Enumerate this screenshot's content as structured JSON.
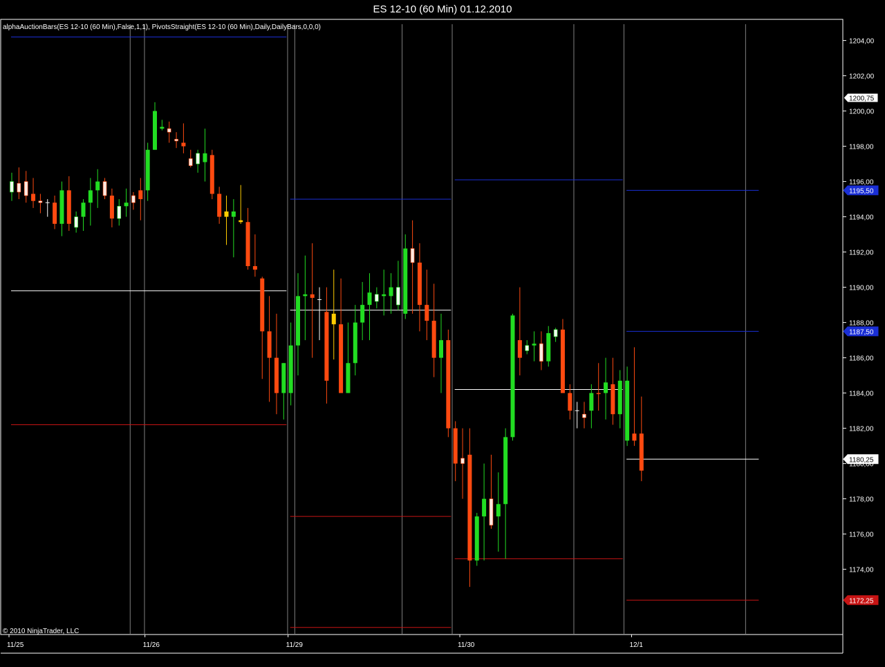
{
  "window": {
    "title": "ES 12-10 (60 Min)  01.12.2010"
  },
  "indicator_label": "alphaAuctionBars(ES 12-10 (60 Min),False,1,1), PivotsStraight(ES 12-10 (60 Min),Daily,DailyBars,0,0,0)",
  "copyright": "© 2010 NinjaTrader, LLC",
  "colors": {
    "background": "#000000",
    "border": "#ffffff",
    "up_strong": "#22dd22",
    "down_strong": "#ff4a10",
    "up_pale": "#eefcee",
    "down_pale": "#ffe8e0",
    "neutral": "#ffcc00",
    "pivot_resistance": "#1a2fd6",
    "pivot_pivot": "#ffffff",
    "pivot_support": "#c81414",
    "session_line": "#808080"
  },
  "price_tags": [
    {
      "label": "1200,75",
      "value": 1200.75,
      "style": "last"
    },
    {
      "label": "1195,50",
      "value": 1195.5,
      "style": "resistance"
    },
    {
      "label": "1187,50",
      "value": 1187.5,
      "style": "resistance"
    },
    {
      "label": "1180,25",
      "value": 1180.25,
      "style": "pivot"
    },
    {
      "label": "1172,25",
      "value": 1172.25,
      "style": "support"
    }
  ],
  "chart_data": {
    "type": "candlestick",
    "title": "ES 12-10 (60 Min)  01.12.2010",
    "ylim": [
      1170.3,
      1205.2
    ],
    "y_ticks": [
      {
        "value": 1174,
        "label": "1174,00"
      },
      {
        "value": 1176,
        "label": "1176,00"
      },
      {
        "value": 1178,
        "label": "1178,00"
      },
      {
        "value": 1180,
        "label": "1180,00"
      },
      {
        "value": 1182,
        "label": "1182,00"
      },
      {
        "value": 1184,
        "label": "1184,00"
      },
      {
        "value": 1186,
        "label": "1186,00"
      },
      {
        "value": 1188,
        "label": "1188,00"
      },
      {
        "value": 1190,
        "label": "1190,00"
      },
      {
        "value": 1192,
        "label": "1192,00"
      },
      {
        "value": 1194,
        "label": "1194,00"
      },
      {
        "value": 1196,
        "label": "1196,00"
      },
      {
        "value": 1198,
        "label": "1198,00"
      },
      {
        "value": 1200,
        "label": "1200,00"
      },
      {
        "value": 1202,
        "label": "1202,00"
      },
      {
        "value": 1204,
        "label": "1204,00"
      }
    ],
    "x_ticks": [
      {
        "bar": 0,
        "label": "11/25"
      },
      {
        "bar": 19,
        "label": "11/26"
      },
      {
        "bar": 39,
        "label": "11/29"
      },
      {
        "bar": 63,
        "label": "11/30"
      },
      {
        "bar": 87,
        "label": "12/1"
      }
    ],
    "session_lines": [
      16,
      18,
      38,
      39,
      54,
      61,
      78,
      85,
      102
    ],
    "pivot_segments": [
      {
        "bar_from": 0,
        "bar_to": 38,
        "r1": 1204.2,
        "pp": 1189.8,
        "s1": 1182.2
      },
      {
        "bar_from": 39,
        "bar_to": 61,
        "r1": 1195.0,
        "pp": 1188.7,
        "s1": 1177.0,
        "s2": 1170.7
      },
      {
        "bar_from": 62,
        "bar_to": 85,
        "r1": 1196.1,
        "pp": 1184.2,
        "s1": 1174.6
      },
      {
        "bar_from": 86,
        "bar_to": 104,
        "r1": 1195.5,
        "r2": 1187.5,
        "pp": 1180.25,
        "s1": 1172.25
      }
    ],
    "bars": [
      {
        "o": 1195.4,
        "h": 1196.5,
        "l": 1194.9,
        "c": 1196.0,
        "t": "upp"
      },
      {
        "o": 1195.9,
        "h": 1196.8,
        "l": 1195.0,
        "c": 1195.4,
        "t": "dnp"
      },
      {
        "o": 1195.2,
        "h": 1196.6,
        "l": 1194.8,
        "c": 1196.0,
        "t": "dnp"
      },
      {
        "o": 1195.3,
        "h": 1196.2,
        "l": 1194.5,
        "c": 1194.9,
        "t": "dn"
      },
      {
        "o": 1194.9,
        "h": 1195.3,
        "l": 1194.2,
        "c": 1194.8,
        "t": "dnp"
      },
      {
        "o": 1194.8,
        "h": 1195.0,
        "l": 1194.0,
        "c": 1194.8,
        "t": "doji"
      },
      {
        "o": 1194.8,
        "h": 1195.2,
        "l": 1193.3,
        "c": 1193.6,
        "t": "dn"
      },
      {
        "o": 1193.6,
        "h": 1196.0,
        "l": 1192.9,
        "c": 1195.5,
        "t": "up"
      },
      {
        "o": 1195.5,
        "h": 1196.3,
        "l": 1193.2,
        "c": 1193.6,
        "t": "dn"
      },
      {
        "o": 1193.4,
        "h": 1194.3,
        "l": 1193.1,
        "c": 1194.0,
        "t": "upp"
      },
      {
        "o": 1194.0,
        "h": 1195.0,
        "l": 1193.2,
        "c": 1194.8,
        "t": "up"
      },
      {
        "o": 1194.8,
        "h": 1196.2,
        "l": 1193.5,
        "c": 1195.5,
        "t": "up"
      },
      {
        "o": 1195.5,
        "h": 1196.7,
        "l": 1194.5,
        "c": 1196.0,
        "t": "up"
      },
      {
        "o": 1196.0,
        "h": 1196.2,
        "l": 1195.0,
        "c": 1195.2,
        "t": "dnp"
      },
      {
        "o": 1195.2,
        "h": 1195.6,
        "l": 1193.4,
        "c": 1193.9,
        "t": "dn"
      },
      {
        "o": 1193.9,
        "h": 1195.0,
        "l": 1193.5,
        "c": 1194.6,
        "t": "upp"
      },
      {
        "o": 1194.6,
        "h": 1195.6,
        "l": 1194.0,
        "c": 1194.8,
        "t": "up"
      },
      {
        "o": 1194.8,
        "h": 1195.4,
        "l": 1194.4,
        "c": 1195.2,
        "t": "dnp"
      },
      {
        "o": 1195.0,
        "h": 1196.2,
        "l": 1193.8,
        "c": 1195.5,
        "t": "dn"
      },
      {
        "o": 1195.5,
        "h": 1198.2,
        "l": 1194.9,
        "c": 1197.8,
        "t": "up"
      },
      {
        "o": 1197.8,
        "h": 1200.5,
        "l": 1197.8,
        "c": 1200.0,
        "t": "up"
      },
      {
        "o": 1199.1,
        "h": 1199.5,
        "l": 1198.9,
        "c": 1199.0,
        "t": "up"
      },
      {
        "o": 1199.0,
        "h": 1199.4,
        "l": 1198.2,
        "c": 1198.8,
        "t": "dnp"
      },
      {
        "o": 1198.3,
        "h": 1198.8,
        "l": 1197.9,
        "c": 1198.4,
        "t": "dnp"
      },
      {
        "o": 1198.2,
        "h": 1199.3,
        "l": 1197.6,
        "c": 1198.0,
        "t": "dn"
      },
      {
        "o": 1197.3,
        "h": 1197.8,
        "l": 1196.8,
        "c": 1196.9,
        "t": "dnp"
      },
      {
        "o": 1197.0,
        "h": 1197.8,
        "l": 1196.5,
        "c": 1197.6,
        "t": "upp"
      },
      {
        "o": 1197.6,
        "h": 1199.0,
        "l": 1196.0,
        "c": 1197.1,
        "t": "up"
      },
      {
        "o": 1197.5,
        "h": 1197.8,
        "l": 1195.0,
        "c": 1195.3,
        "t": "dn"
      },
      {
        "o": 1195.3,
        "h": 1195.7,
        "l": 1193.6,
        "c": 1194.0,
        "t": "dn"
      },
      {
        "o": 1194.0,
        "h": 1195.2,
        "l": 1192.4,
        "c": 1194.3,
        "t": "neu"
      },
      {
        "o": 1194.3,
        "h": 1195.0,
        "l": 1191.7,
        "c": 1194.0,
        "t": "up"
      },
      {
        "o": 1193.8,
        "h": 1195.8,
        "l": 1193.6,
        "c": 1193.7,
        "t": "neu"
      },
      {
        "o": 1193.7,
        "h": 1194.5,
        "l": 1191.0,
        "c": 1191.2,
        "t": "dn"
      },
      {
        "o": 1191.2,
        "h": 1193.0,
        "l": 1190.6,
        "c": 1191.0,
        "t": "dn"
      },
      {
        "o": 1190.5,
        "h": 1190.6,
        "l": 1184.8,
        "c": 1187.5,
        "t": "dn"
      },
      {
        "o": 1187.5,
        "h": 1189.5,
        "l": 1183.5,
        "c": 1186.0,
        "t": "dn"
      },
      {
        "o": 1186.0,
        "h": 1188.5,
        "l": 1182.8,
        "c": 1184.0,
        "t": "dn"
      },
      {
        "o": 1184.0,
        "h": 1185.7,
        "l": 1182.5,
        "c": 1185.7,
        "t": "up"
      },
      {
        "o": 1184.0,
        "h": 1188.0,
        "l": 1183.3,
        "c": 1186.7,
        "t": "up"
      },
      {
        "o": 1186.7,
        "h": 1190.8,
        "l": 1185.0,
        "c": 1189.5,
        "t": "up"
      },
      {
        "o": 1189.5,
        "h": 1191.8,
        "l": 1187.0,
        "c": 1189.6,
        "t": "up"
      },
      {
        "o": 1189.6,
        "h": 1192.5,
        "l": 1186.0,
        "c": 1189.4,
        "t": "dn"
      },
      {
        "o": 1189.0,
        "h": 1190.0,
        "l": 1187.0,
        "c": 1189.3,
        "t": "doji"
      },
      {
        "o": 1188.6,
        "h": 1190.0,
        "l": 1183.4,
        "c": 1184.7,
        "t": "dn"
      },
      {
        "o": 1188.5,
        "h": 1191.0,
        "l": 1185.9,
        "c": 1187.9,
        "t": "neu"
      },
      {
        "o": 1187.9,
        "h": 1190.5,
        "l": 1185.0,
        "c": 1184.0,
        "t": "dn"
      },
      {
        "o": 1184.0,
        "h": 1188.0,
        "l": 1184.0,
        "c": 1185.7,
        "t": "up"
      },
      {
        "o": 1185.7,
        "h": 1189.0,
        "l": 1185.0,
        "c": 1188.0,
        "t": "up"
      },
      {
        "o": 1188.0,
        "h": 1190.3,
        "l": 1187.0,
        "c": 1189.0,
        "t": "up"
      },
      {
        "o": 1189.0,
        "h": 1190.8,
        "l": 1187.0,
        "c": 1189.7,
        "t": "up"
      },
      {
        "o": 1189.2,
        "h": 1190.0,
        "l": 1188.8,
        "c": 1189.6,
        "t": "upp"
      },
      {
        "o": 1189.6,
        "h": 1191.0,
        "l": 1188.4,
        "c": 1189.5,
        "t": "up"
      },
      {
        "o": 1189.5,
        "h": 1190.8,
        "l": 1188.5,
        "c": 1190.0,
        "t": "up"
      },
      {
        "o": 1190.0,
        "h": 1191.5,
        "l": 1188.7,
        "c": 1189.0,
        "t": "upp"
      },
      {
        "o": 1188.5,
        "h": 1193.0,
        "l": 1188.2,
        "c": 1192.2,
        "t": "up"
      },
      {
        "o": 1192.2,
        "h": 1193.8,
        "l": 1188.5,
        "c": 1191.4,
        "t": "dnp"
      },
      {
        "o": 1191.4,
        "h": 1192.5,
        "l": 1187.5,
        "c": 1189.0,
        "t": "dn"
      },
      {
        "o": 1189.0,
        "h": 1191.0,
        "l": 1187.0,
        "c": 1188.1,
        "t": "dn"
      },
      {
        "o": 1188.1,
        "h": 1190.2,
        "l": 1184.9,
        "c": 1186.0,
        "t": "dn"
      },
      {
        "o": 1186.0,
        "h": 1188.5,
        "l": 1184.0,
        "c": 1187.0,
        "t": "up"
      },
      {
        "o": 1187.0,
        "h": 1187.6,
        "l": 1181.5,
        "c": 1182.0,
        "t": "dn"
      },
      {
        "o": 1182.0,
        "h": 1182.4,
        "l": 1179.0,
        "c": 1180.0,
        "t": "dn"
      },
      {
        "o": 1180.0,
        "h": 1182.0,
        "l": 1178.0,
        "c": 1180.3,
        "t": "dnp"
      },
      {
        "o": 1180.5,
        "h": 1182.0,
        "l": 1173.0,
        "c": 1174.5,
        "t": "dn"
      },
      {
        "o": 1174.5,
        "h": 1177.2,
        "l": 1174.2,
        "c": 1177.0,
        "t": "up"
      },
      {
        "o": 1177.0,
        "h": 1180.0,
        "l": 1174.5,
        "c": 1178.0,
        "t": "up"
      },
      {
        "o": 1178.0,
        "h": 1180.5,
        "l": 1176.3,
        "c": 1176.5,
        "t": "dnp"
      },
      {
        "o": 1177.0,
        "h": 1179.5,
        "l": 1175.0,
        "c": 1177.7,
        "t": "up"
      },
      {
        "o": 1177.7,
        "h": 1182.0,
        "l": 1174.6,
        "c": 1181.5,
        "t": "up"
      },
      {
        "o": 1181.5,
        "h": 1188.5,
        "l": 1181.3,
        "c": 1188.4,
        "t": "up"
      },
      {
        "o": 1187.0,
        "h": 1190.0,
        "l": 1185.0,
        "c": 1186.0,
        "t": "dn"
      },
      {
        "o": 1186.4,
        "h": 1187.0,
        "l": 1186.2,
        "c": 1186.7,
        "t": "upp"
      },
      {
        "o": 1186.7,
        "h": 1187.5,
        "l": 1185.8,
        "c": 1186.8,
        "t": "up"
      },
      {
        "o": 1186.8,
        "h": 1187.5,
        "l": 1185.3,
        "c": 1185.8,
        "t": "dnp"
      },
      {
        "o": 1185.8,
        "h": 1187.8,
        "l": 1185.5,
        "c": 1187.4,
        "t": "up"
      },
      {
        "o": 1187.2,
        "h": 1187.7,
        "l": 1186.9,
        "c": 1187.6,
        "t": "upp"
      },
      {
        "o": 1187.6,
        "h": 1188.2,
        "l": 1184.0,
        "c": 1184.0,
        "t": "dn"
      },
      {
        "o": 1184.0,
        "h": 1184.5,
        "l": 1182.5,
        "c": 1183.0,
        "t": "dn"
      },
      {
        "o": 1183.0,
        "h": 1183.5,
        "l": 1182.0,
        "c": 1183.0,
        "t": "doji"
      },
      {
        "o": 1182.6,
        "h": 1183.5,
        "l": 1182.0,
        "c": 1182.8,
        "t": "dnp"
      },
      {
        "o": 1183.0,
        "h": 1184.5,
        "l": 1182.0,
        "c": 1184.0,
        "t": "up"
      },
      {
        "o": 1184.0,
        "h": 1185.7,
        "l": 1183.0,
        "c": 1184.0,
        "t": "dn"
      },
      {
        "o": 1184.0,
        "h": 1186.0,
        "l": 1182.5,
        "c": 1184.6,
        "t": "up"
      },
      {
        "o": 1184.5,
        "h": 1186.0,
        "l": 1182.2,
        "c": 1182.8,
        "t": "dn"
      },
      {
        "o": 1182.8,
        "h": 1185.3,
        "l": 1182.0,
        "c": 1184.7,
        "t": "up"
      },
      {
        "o": 1184.7,
        "h": 1185.5,
        "l": 1181.0,
        "c": 1181.3,
        "t": "up"
      },
      {
        "o": 1181.3,
        "h": 1186.6,
        "l": 1181.0,
        "c": 1181.7,
        "t": "dn"
      },
      {
        "o": 1181.7,
        "h": 1183.8,
        "l": 1179.0,
        "c": 1179.6,
        "t": "dn"
      }
    ]
  }
}
